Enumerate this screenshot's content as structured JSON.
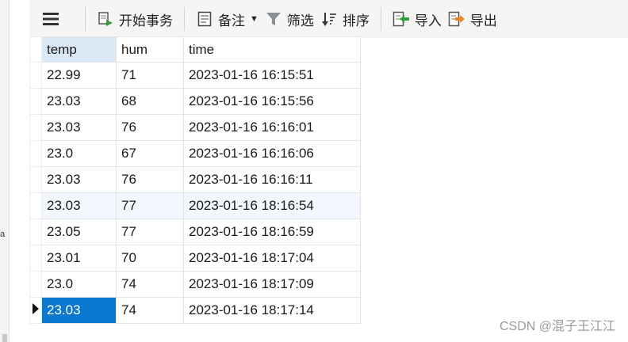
{
  "toolbar": {
    "menu_icon": "hamburger-menu-icon",
    "begin_transaction": "开始事务",
    "notes": "备注",
    "filter": "筛选",
    "sort": "排序",
    "import": "导入",
    "export": "导出"
  },
  "left_panel": {
    "fragment": "a"
  },
  "table": {
    "columns": [
      "temp",
      "hum",
      "time"
    ],
    "rows": [
      [
        "22.99",
        "71",
        "2023-01-16 16:15:51"
      ],
      [
        "23.03",
        "68",
        "2023-01-16 16:15:56"
      ],
      [
        "23.03",
        "76",
        "2023-01-16 16:16:01"
      ],
      [
        "23.0",
        "67",
        "2023-01-16 16:16:06"
      ],
      [
        "23.03",
        "76",
        "2023-01-16 16:16:11"
      ],
      [
        "23.03",
        "77",
        "2023-01-16 18:16:54"
      ],
      [
        "23.05",
        "77",
        "2023-01-16 18:16:59"
      ],
      [
        "23.01",
        "70",
        "2023-01-16 18:17:04"
      ],
      [
        "23.0",
        "74",
        "2023-01-16 18:17:09"
      ],
      [
        "23.03",
        "74",
        "2023-01-16 18:17:14"
      ]
    ]
  },
  "colors": {
    "selection": "#0b78d0",
    "header_active": "#dbe9f7",
    "row_hover": "#f1f7fd"
  },
  "watermark": "CSDN @混子王江江"
}
